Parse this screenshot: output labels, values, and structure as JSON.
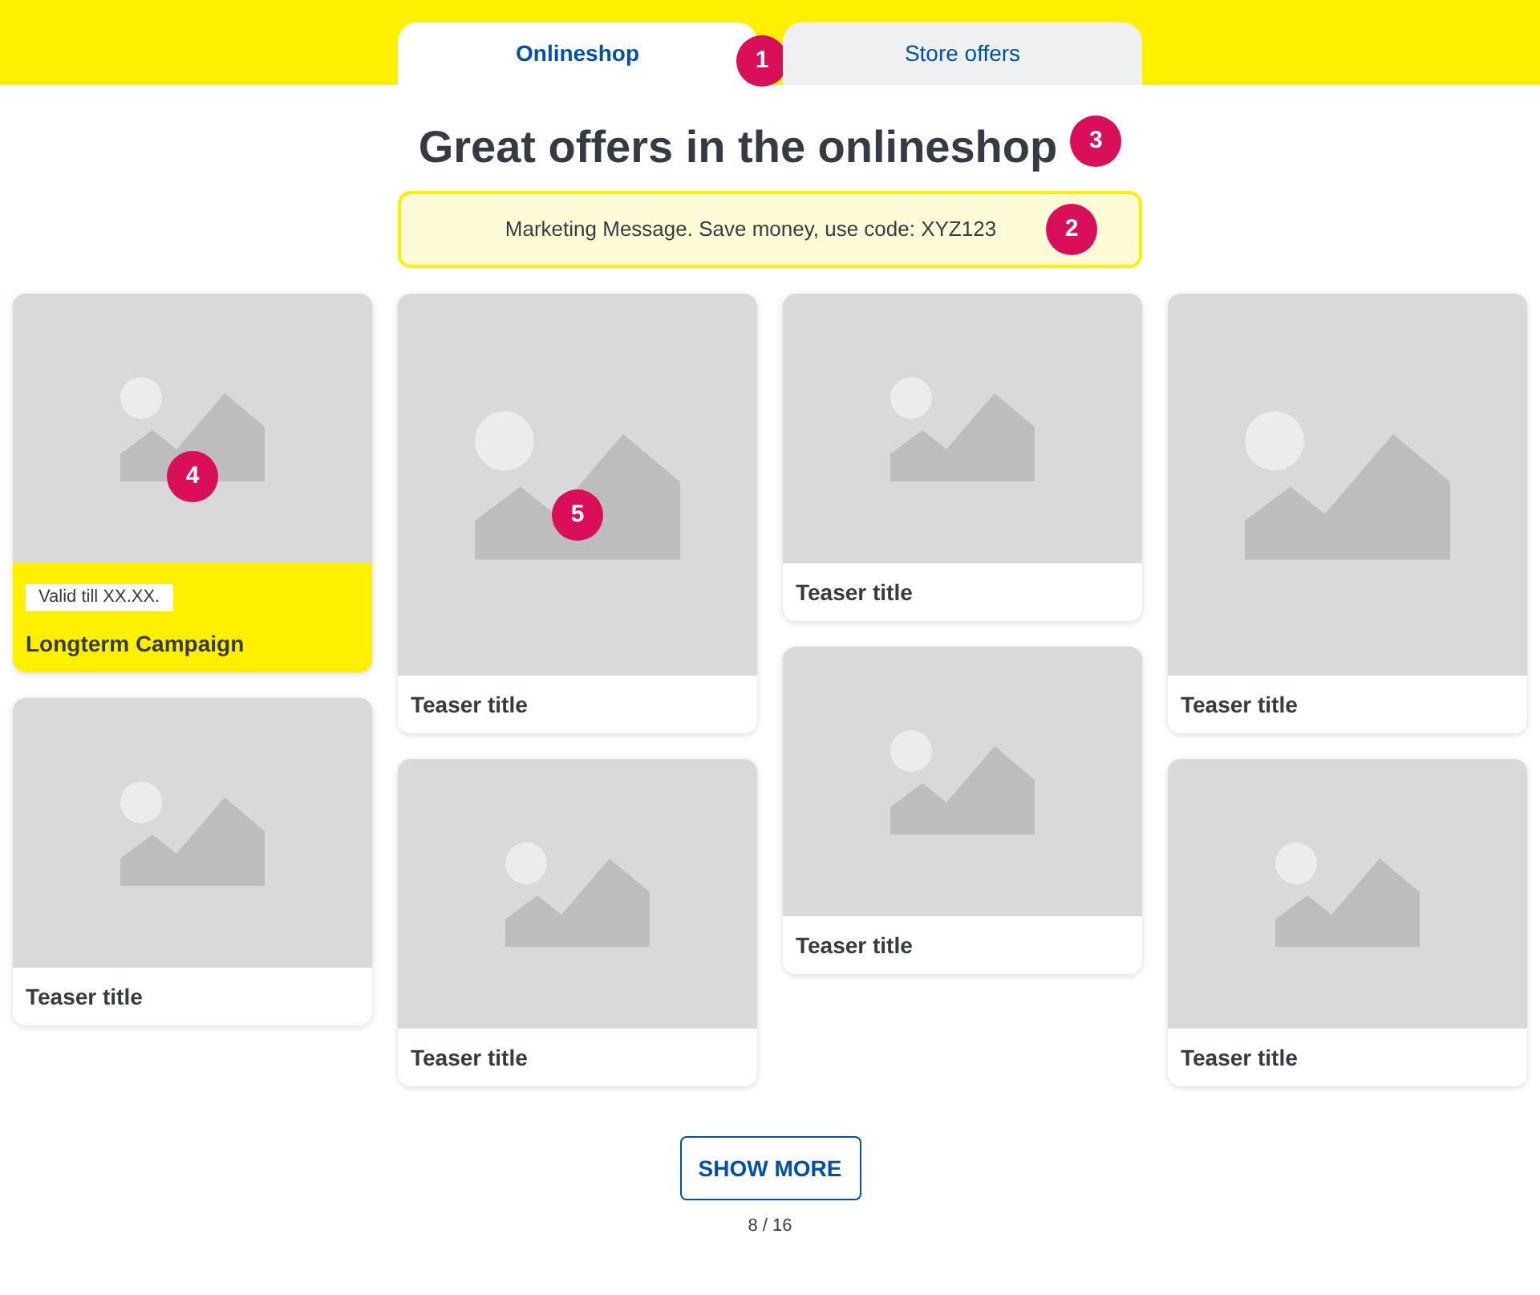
{
  "tabs": [
    {
      "label": "Onlineshop",
      "selected": true,
      "marker": "1"
    },
    {
      "label": "Store offers",
      "selected": false
    }
  ],
  "heading": {
    "text": "Great offers in the onlineshop",
    "marker": "3"
  },
  "message": {
    "text": "Marketing Message. Save money, use code: XYZ123",
    "marker": "2"
  },
  "columns": [
    {
      "cards": [
        {
          "kind": "campaign",
          "badge": "Valid till XX.XX.",
          "title": "Longterm Campaign",
          "marker": "4"
        },
        {
          "kind": "teaser",
          "title": "Teaser title"
        }
      ]
    },
    {
      "cards": [
        {
          "kind": "teaser-tall",
          "title": "Teaser title",
          "marker": "5"
        },
        {
          "kind": "teaser",
          "title": "Teaser title"
        }
      ]
    },
    {
      "cards": [
        {
          "kind": "teaser",
          "title": "Teaser title"
        },
        {
          "kind": "teaser",
          "title": "Teaser title"
        }
      ]
    },
    {
      "cards": [
        {
          "kind": "teaser-tall",
          "title": "Teaser title"
        },
        {
          "kind": "teaser",
          "title": "Teaser title"
        }
      ]
    }
  ],
  "pagination": {
    "button": "SHOW MORE",
    "count": "8 / 16"
  }
}
